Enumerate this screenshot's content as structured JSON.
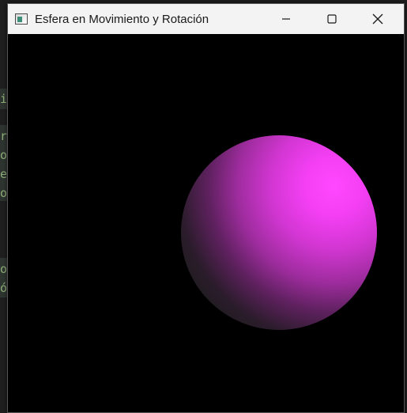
{
  "window": {
    "title": "Esfera en Movimiento y Rotación",
    "controls": {
      "minimize": "minimize",
      "maximize": "maximize",
      "close": "close"
    }
  },
  "scene": {
    "background_color": "#000000",
    "sphere_color": "#ff48ff",
    "shadow_color": "#181818"
  },
  "background_editor": {
    "fragments": [
      "ió",
      "ra",
      "o",
      "er",
      "o",
      "o",
      "ó"
    ]
  }
}
